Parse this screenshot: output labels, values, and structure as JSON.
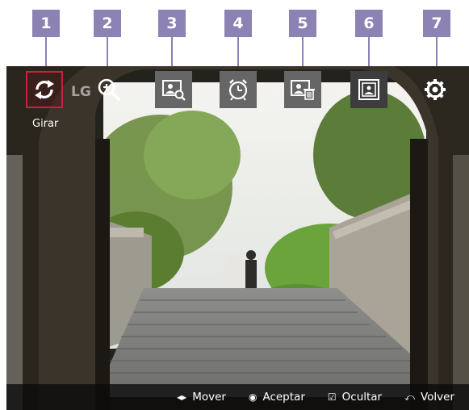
{
  "callouts": [
    "1",
    "2",
    "3",
    "4",
    "5",
    "6",
    "7"
  ],
  "brand": "LG",
  "toolbar": {
    "rotate": {
      "label": "Girar",
      "icon": "rotate-icon"
    },
    "zoom": {
      "icon": "zoom-in-icon"
    },
    "search_photo": {
      "icon": "photo-search-icon"
    },
    "timer": {
      "icon": "alarm-clock-icon"
    },
    "delete_photo": {
      "icon": "photo-delete-icon"
    },
    "slideshow": {
      "icon": "photo-frame-icon"
    },
    "settings": {
      "icon": "gear-icon"
    }
  },
  "hints": [
    {
      "glyph": "◂▸",
      "label": "Mover",
      "icon": "move-arrows-icon"
    },
    {
      "glyph": "◉",
      "label": "Aceptar",
      "icon": "ok-icon"
    },
    {
      "glyph": "☑",
      "label": "Ocultar",
      "icon": "hide-checkbox-icon"
    },
    {
      "glyph": "⤺",
      "label": "Volver",
      "icon": "back-icon"
    }
  ],
  "colors": {
    "callout": "#8c82b4",
    "selected_border": "#c5243c",
    "button_bg": "#666666"
  }
}
